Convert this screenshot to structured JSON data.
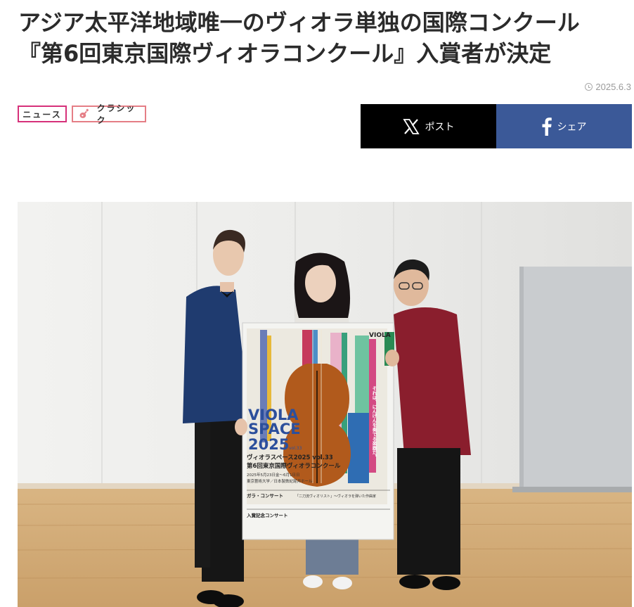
{
  "article": {
    "title_line1": "アジア太平洋地域唯一のヴィオラ単独の国際コンクール",
    "title_line2": "『第6回東京国際ヴィオラコンクール』入賞者が決定",
    "date": "2025.6.3"
  },
  "tags": {
    "news": "ニュース",
    "classic": "クラシック"
  },
  "share": {
    "x_label": "ポスト",
    "facebook_label": "シェア"
  },
  "poster": {
    "brand": "VIOLA",
    "headline_1": "VIOLA",
    "headline_2": "SPACE",
    "headline_3": "2025",
    "vol": "vol.33",
    "subtitle_1": "ヴィオラスペース2025 vol.33",
    "subtitle_2": "第6回東京国際ヴィオラコンクール",
    "dates": "2025年5月23日金〜6月1日日",
    "venue": "東京藝術大学／日本製鉄紀尾井ホール",
    "gala": "ガラ・コンサート",
    "gala_sub": "「二刀流ヴィオリスト」〜ヴィオラを弾いた作曲家",
    "award": "入賞記念コンサート",
    "vertical_text": "それは、にんげんを奏でる楽器だ。"
  },
  "colors": {
    "news_border": "#d6317a",
    "classic_border": "#e57e86",
    "x_bg": "#000000",
    "facebook_bg": "#3b5998"
  }
}
